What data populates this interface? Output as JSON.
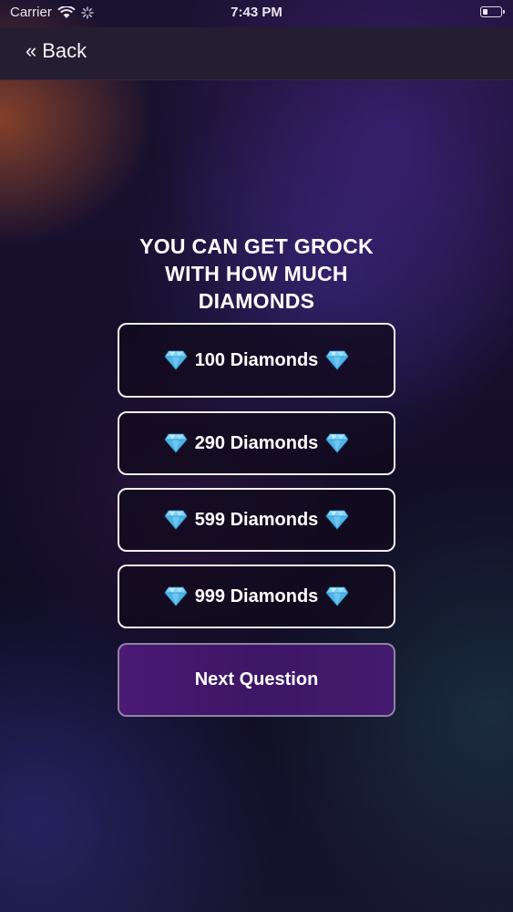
{
  "status_bar": {
    "carrier": "Carrier",
    "time": "7:43 PM"
  },
  "nav": {
    "back_chevron": "«",
    "back_label": "Back"
  },
  "question": {
    "lines": [
      "YOU CAN GET GROCK",
      "WITH HOW MUCH",
      "DIAMONDS"
    ]
  },
  "options": [
    {
      "label": "100 Diamonds",
      "icon": "diamond-icon"
    },
    {
      "label": "290 Diamonds",
      "icon": "diamond-icon"
    },
    {
      "label": "599 Diamonds",
      "icon": "diamond-icon"
    },
    {
      "label": "999 Diamonds",
      "icon": "diamond-icon"
    }
  ],
  "next_button": {
    "label": "Next Question"
  },
  "colors": {
    "nav_background": "#251e31",
    "option_border": "#f2f0f6",
    "next_button_fill": "#4a1a74",
    "diamond": "#7fd3f5"
  }
}
